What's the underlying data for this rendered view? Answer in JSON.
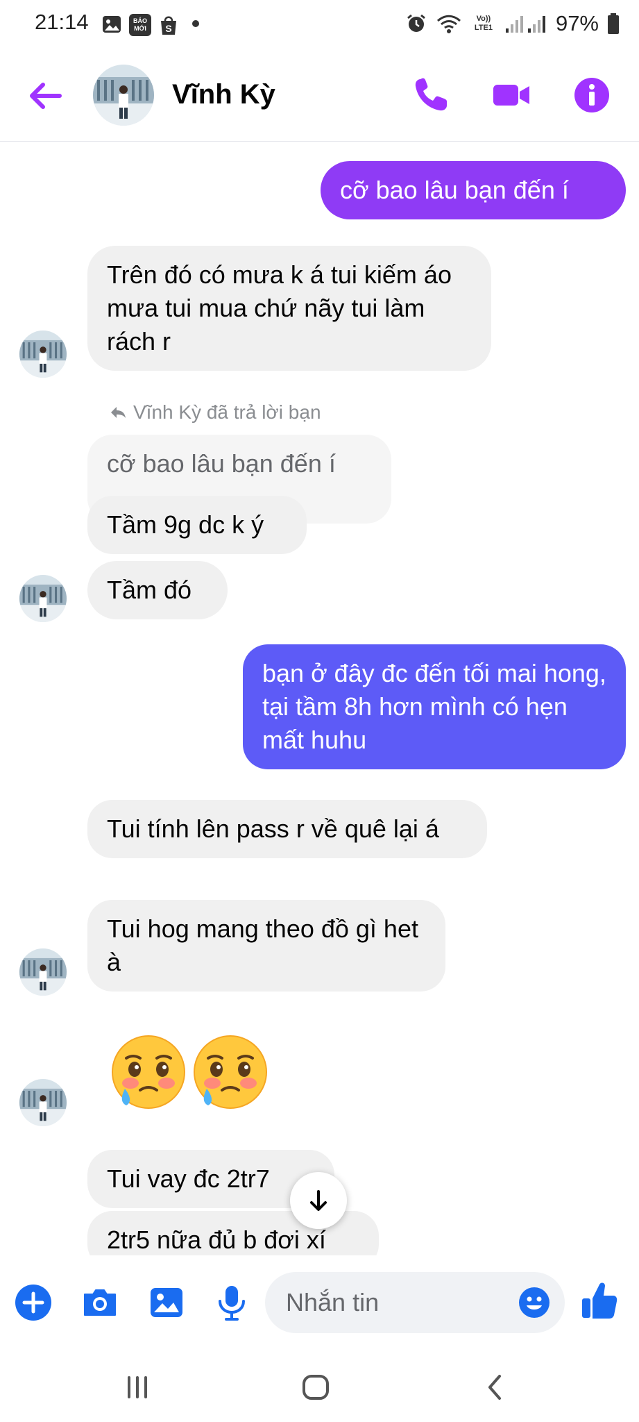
{
  "status_bar": {
    "time": "21:14",
    "battery": "97%",
    "icons": [
      "gallery-icon",
      "bao-moi-icon",
      "shopee-icon",
      "dot-icon",
      "alarm-icon",
      "wifi-icon",
      "volte-icon",
      "signal-icon",
      "battery-icon"
    ],
    "bao_moi_text": "BÁO MỚI",
    "volte_text": "Vo)) LTE1"
  },
  "header": {
    "contact_name": "Vĩnh Kỳ",
    "icons": [
      "back-arrow-icon",
      "phone-icon",
      "video-icon",
      "info-icon"
    ]
  },
  "colors": {
    "accent": "#a033ff",
    "outgoing_purple": "#8f3bf5",
    "outgoing_blue": "#5d5bf7",
    "incoming_bg": "#f0f0f0",
    "secondary_text": "#65676b"
  },
  "messages": [
    {
      "id": "m1",
      "direction": "out",
      "text": "cỡ bao lâu bạn đến í"
    },
    {
      "id": "m2",
      "direction": "in",
      "text": "Trên đó có mưa k á tui kiếm áo mưa tui mua chứ nãy tui làm rách r"
    },
    {
      "id": "m3",
      "direction": "reply_context",
      "label": "Vĩnh Kỳ đã trả lời bạn",
      "quoted": "cỡ bao lâu bạn đến í"
    },
    {
      "id": "m4",
      "direction": "in",
      "text": "Tầm 9g dc k ý"
    },
    {
      "id": "m5",
      "direction": "in",
      "text": "Tầm đó"
    },
    {
      "id": "m6",
      "direction": "out",
      "text": "bạn ở đây đc đến tối mai hong, tại tầm 8h hơn mình có hẹn mất huhu"
    },
    {
      "id": "m7",
      "direction": "in",
      "text": "Tui tính lên pass r về quê lại á"
    },
    {
      "id": "m8",
      "direction": "in",
      "text": "Tui hog mang theo đồ gì het à"
    },
    {
      "id": "m9",
      "direction": "in",
      "emoji": [
        "face-holding-back-tears",
        "face-holding-back-tears"
      ]
    },
    {
      "id": "m10",
      "direction": "in",
      "text": "Tui vay đc 2tr7"
    },
    {
      "id": "m11",
      "direction": "in",
      "text": "2tr5 nữa đủ b đơi xí"
    }
  ],
  "composer": {
    "placeholder": "Nhắn tin",
    "value": "",
    "icons": [
      "plus-icon",
      "camera-icon",
      "gallery-icon",
      "microphone-icon",
      "emoji-icon",
      "thumbs-up-icon"
    ]
  },
  "navbar": {
    "icons": [
      "recents-icon",
      "home-icon",
      "back-icon"
    ]
  }
}
